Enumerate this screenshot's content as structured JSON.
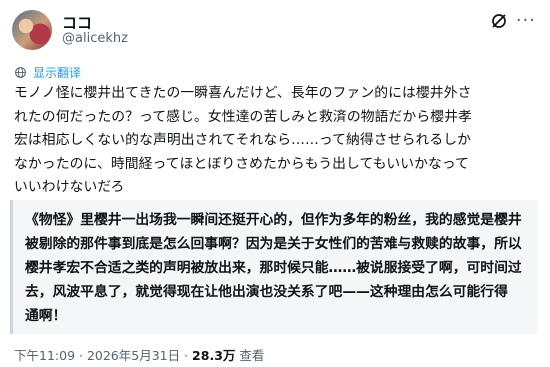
{
  "user": {
    "name": "ココ",
    "handle": "@alicekhz"
  },
  "translate": {
    "label": "显示翻译"
  },
  "tweet": {
    "lines": [
      "モノノ怪に櫻井出てきたの一瞬喜んだけど、長年のファン的には櫻井外さ",
      "れたの何だったの？って感じ。女性達の苦しみと救済の物語だから櫻井孝",
      "宏は相応しくない的な声明出されてそれなら……って納得させられるしか",
      "なかったのに、時間経ってほとぼりさめたからもう出してもいいかなって",
      "いいわけないだろ"
    ]
  },
  "translation": {
    "lines": [
      "《物怪》里樱井一出场我一瞬间还挺开心的，但作为多年的粉丝，我的感觉是樱井",
      "被剔除的那件事到底是怎么回事啊？因为是关于女性们的苦难与救赎的故事，所以",
      "樱井孝宏不合适之类的声明被放出来，那时候只能……被说服接受了啊，可时间过",
      "去，风波平息了，就觉得现在让他出演也没关系了吧——这种理由怎么可能行得",
      "通啊！"
    ]
  },
  "meta": {
    "time": "下午11:09",
    "sep1": " · ",
    "date": "2026年5月31日",
    "sep2": " · ",
    "views": "28.3万",
    "views_label": " 查看"
  },
  "colors": {
    "accent": "#1d9bf0",
    "muted": "#536471",
    "quote_bg": "#f4f6f8",
    "quote_border": "#cfd5db"
  }
}
